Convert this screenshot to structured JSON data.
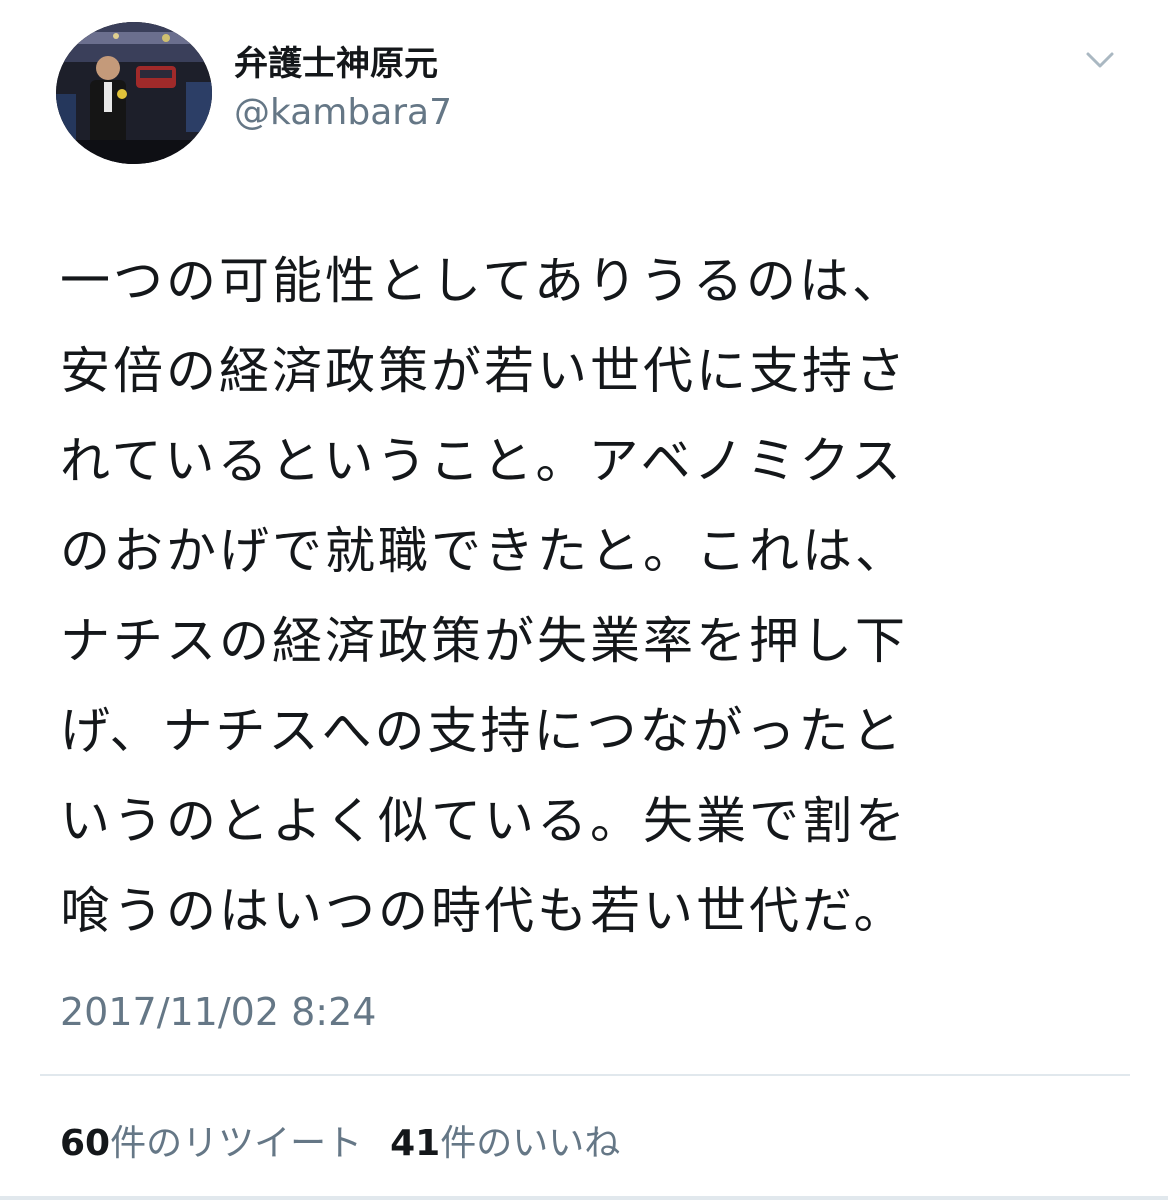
{
  "author": {
    "display_name": "弁護士神原元",
    "handle": "@kambara7",
    "avatar": "avatar-photo"
  },
  "menu": {
    "icon": "chevron-down-icon"
  },
  "tweet": {
    "lines": [
      "一つの可能性としてありうるのは、",
      "安倍の経済政策が若い世代に支持さ",
      "れているということ。アベノミクス",
      "のおかげで就職できたと。これは、",
      "ナチスの経済政策が失業率を押し下",
      "げ、ナチスへの支持につながったと",
      "いうのとよく似ている。失業で割を",
      "喰うのはいつの時代も若い世代だ。"
    ],
    "timestamp": "2017/11/02 8:24"
  },
  "stats": {
    "retweets_count": "60",
    "retweets_label": "件のリツイート",
    "likes_count": "41",
    "likes_label": "件のいいね"
  },
  "colors": {
    "text": "#14171a",
    "secondary": "#657786",
    "divider": "#e1e8ed"
  }
}
